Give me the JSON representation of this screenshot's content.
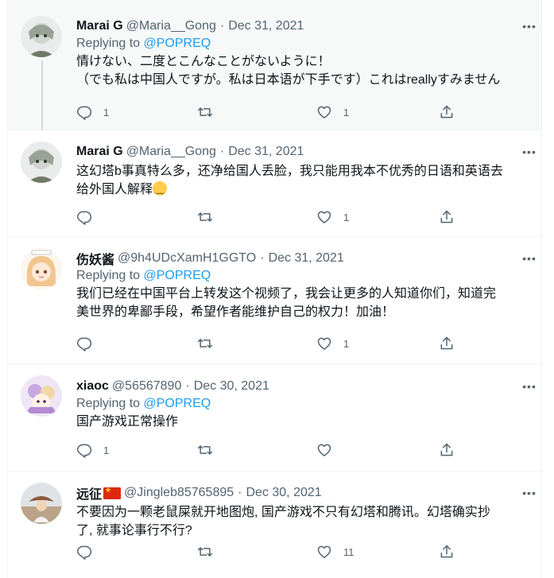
{
  "tweets": [
    {
      "name": "Marai G",
      "handle": "@Maria__Gong",
      "date": "Dec 31, 2021",
      "replying_prefix": "Replying to ",
      "replying_to": "@POPREQ",
      "text": "情けない、二度とこんなことがないように！\n（でも私は中国人ですが。私は日本语が下手です）これはreallyすみません",
      "replies": "1",
      "retweets": "",
      "likes": "1"
    },
    {
      "name": "Marai G",
      "handle": "@Maria__Gong",
      "date": "Dec 31, 2021",
      "text_line1": "这幻塔b事真特么多，还净给国人丢脸，我只能用我本不优秀的日语和英语去",
      "text_line2": "给外国人解释",
      "replies": "",
      "retweets": "",
      "likes": "1"
    },
    {
      "name": "伤妖酱",
      "handle": "@9h4UDcXamH1GGTO",
      "date": "Dec 31, 2021",
      "replying_prefix": "Replying to ",
      "replying_to": "@POPREQ",
      "text": "我们已经在中国平台上转发这个视频了，我会让更多的人知道你们，知道完\n美世界的卑鄙手段，希望作者能维护自己的权力！加油！",
      "replies": "",
      "retweets": "",
      "likes": "1"
    },
    {
      "name": "xiaoc",
      "handle": "@56567890",
      "date": "Dec 30, 2021",
      "replying_prefix": "Replying to ",
      "replying_to": "@POPREQ",
      "text": "国产游戏正常操作",
      "replies": "1",
      "retweets": "",
      "likes": ""
    },
    {
      "name": "远征",
      "handle": "@Jingleb85765895",
      "date": "Dec 30, 2021",
      "text": "不要因为一颗老鼠屎就开地图炮, 国产游戏不只有幻塔和腾讯。幻塔确实抄\n了, 就事论事行不行?",
      "replies": "",
      "retweets": "",
      "likes": "11"
    }
  ],
  "dot": "·",
  "more_glyph": "•••",
  "icons": {
    "reply": "reply-icon",
    "retweet": "retweet-icon",
    "like": "like-icon",
    "share": "share-icon",
    "more": "more-icon"
  },
  "colors": {
    "link": "#1d9bf0",
    "muted": "#536471",
    "highlight_bg": "#f7f9f9"
  }
}
